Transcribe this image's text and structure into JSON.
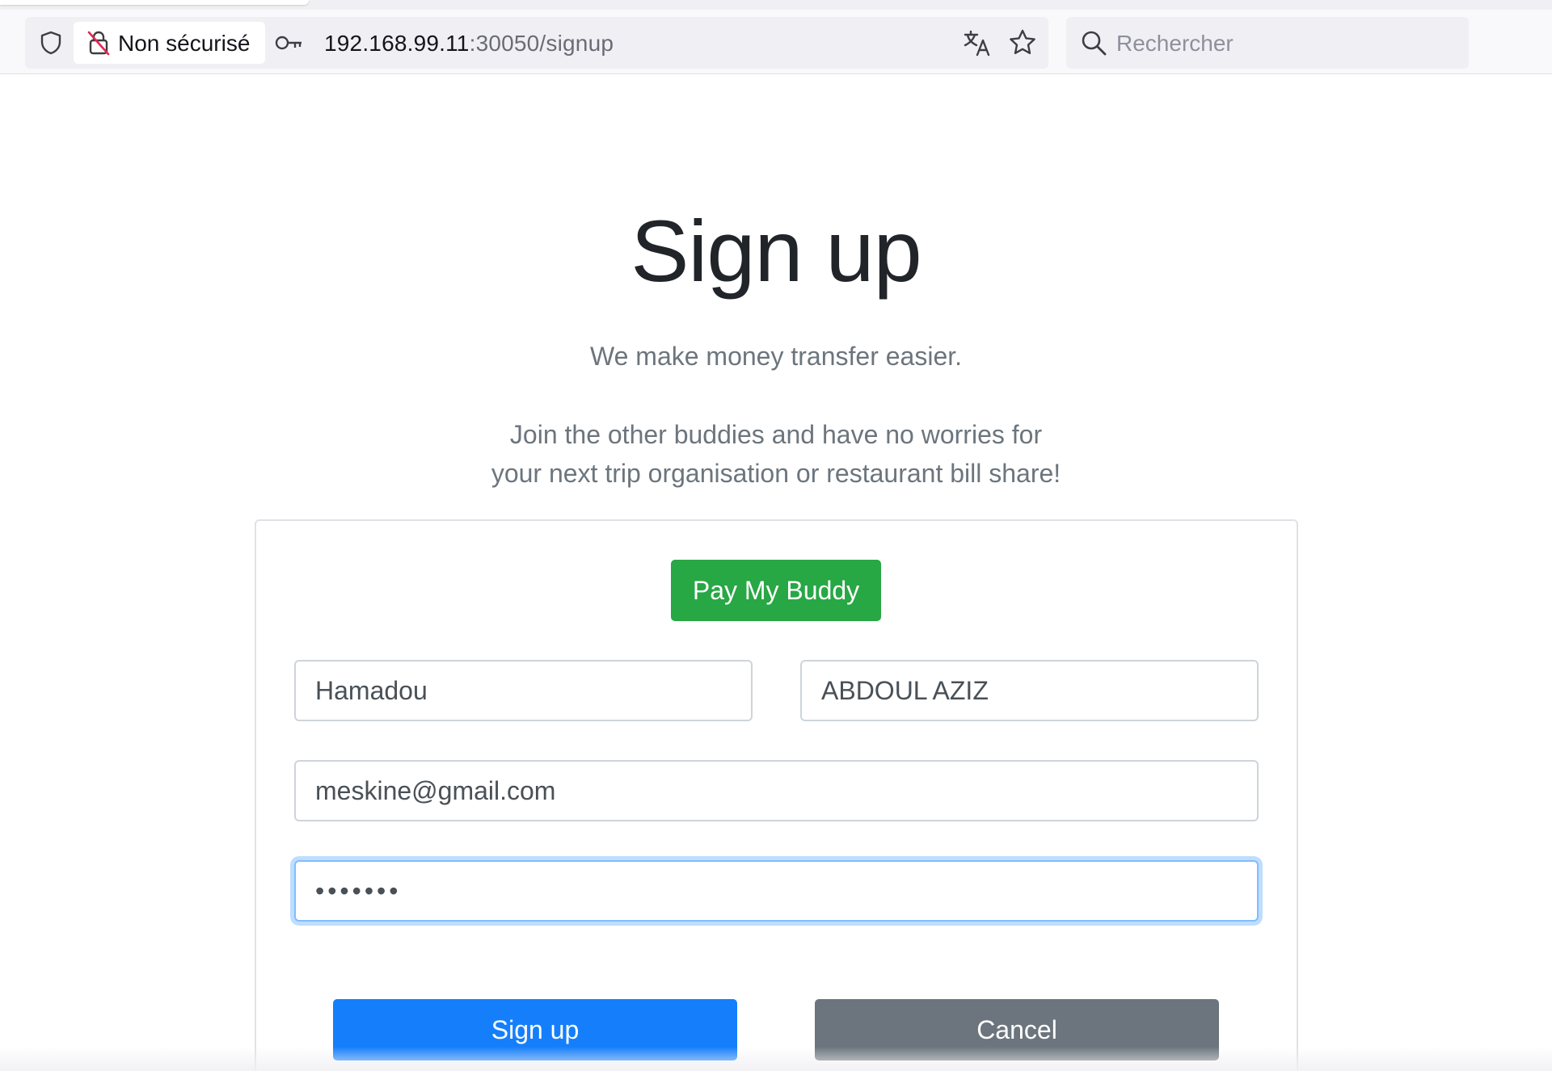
{
  "browser": {
    "security_label": "Non sécurisé",
    "url_host": "192.168.99.11",
    "url_rest": ":30050/signup",
    "search_placeholder": "Rechercher",
    "icons": [
      "shield-icon",
      "lock-off-icon",
      "key-icon",
      "translate-icon",
      "star-icon",
      "search-icon"
    ]
  },
  "page": {
    "title": "Sign up",
    "lead_line1": "We make money transfer easier.",
    "lead_line2": "Join the other buddies and have no worries for",
    "lead_line3": "your next trip organisation or restaurant bill share!"
  },
  "form": {
    "brand_button_label": "Pay My Buddy",
    "first_name_value": "Hamadou",
    "last_name_value": "ABDOUL AZIZ",
    "email_value": "meskine@gmail.com",
    "password_value": "•••••••",
    "signup_label": "Sign up",
    "cancel_label": "Cancel"
  },
  "colors": {
    "brand_green": "#28a745",
    "primary_blue": "#157ffb",
    "secondary_gray": "#6c757d",
    "focus_blue": "#80bdff"
  }
}
